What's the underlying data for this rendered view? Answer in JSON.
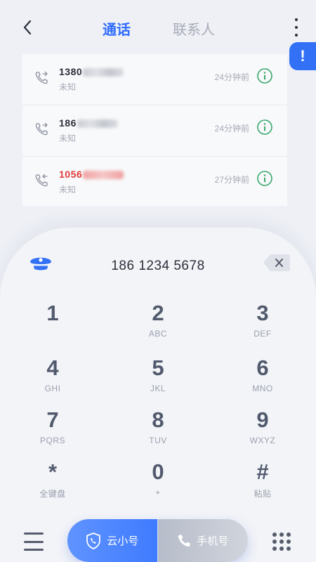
{
  "header": {
    "tab_calls": "通话",
    "tab_contacts": "联系人",
    "alert_badge": "!"
  },
  "calls": [
    {
      "number_prefix": "1380",
      "number_suffix": "",
      "label": "未知",
      "time": "24分钟前",
      "missed": false
    },
    {
      "number_prefix": "186",
      "number_suffix": "",
      "label": "未知",
      "time": "24分钟前",
      "missed": false
    },
    {
      "number_prefix": "1056",
      "number_suffix": "",
      "label": "未知",
      "time": "27分钟前",
      "missed": true
    }
  ],
  "dialpad": {
    "number": "186 1234 5678",
    "keys": [
      {
        "digit": "1",
        "letters": ""
      },
      {
        "digit": "2",
        "letters": "ABC"
      },
      {
        "digit": "3",
        "letters": "DEF"
      },
      {
        "digit": "4",
        "letters": "GHI"
      },
      {
        "digit": "5",
        "letters": "JKL"
      },
      {
        "digit": "6",
        "letters": "MNO"
      },
      {
        "digit": "7",
        "letters": "PQRS"
      },
      {
        "digit": "8",
        "letters": "TUV"
      },
      {
        "digit": "9",
        "letters": "WXYZ"
      },
      {
        "digit": "*",
        "letters": "全键盘"
      },
      {
        "digit": "0",
        "letters": "+"
      },
      {
        "digit": "#",
        "letters": "粘贴"
      }
    ]
  },
  "bottom": {
    "cloud_call_label": "云小号",
    "phone_call_label": "手机号"
  },
  "colors": {
    "accent": "#2f6bff",
    "missed": "#e23b3b",
    "info_green": "#3aa86b"
  },
  "icons": {
    "back": "chevron-left-icon",
    "more": "more-vertical-icon",
    "hat": "police-hat-icon",
    "backspace": "backspace-icon",
    "menu": "menu-icon",
    "grid": "dialpad-grid-icon"
  }
}
